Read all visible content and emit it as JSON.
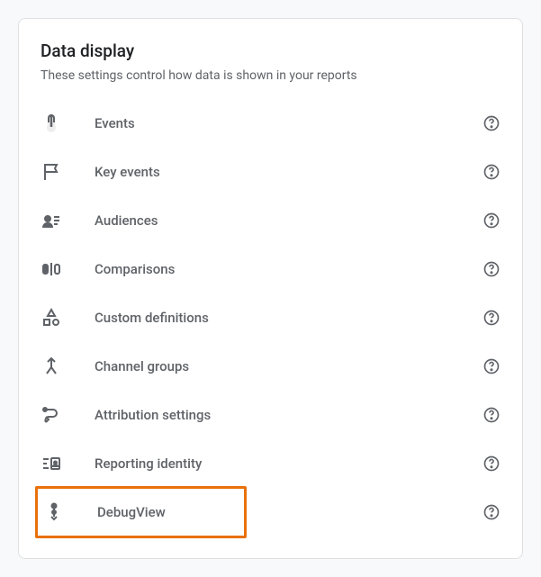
{
  "section": {
    "title": "Data display",
    "subtitle": "These settings control how data is shown in your reports"
  },
  "items": [
    {
      "label": "Events",
      "icon": "touch-icon"
    },
    {
      "label": "Key events",
      "icon": "flag-icon"
    },
    {
      "label": "Audiences",
      "icon": "audience-icon"
    },
    {
      "label": "Comparisons",
      "icon": "comparison-icon"
    },
    {
      "label": "Custom definitions",
      "icon": "shapes-icon"
    },
    {
      "label": "Channel groups",
      "icon": "merge-icon"
    },
    {
      "label": "Attribution settings",
      "icon": "path-icon"
    },
    {
      "label": "Reporting identity",
      "icon": "identity-icon"
    },
    {
      "label": "DebugView",
      "icon": "debug-icon"
    }
  ]
}
